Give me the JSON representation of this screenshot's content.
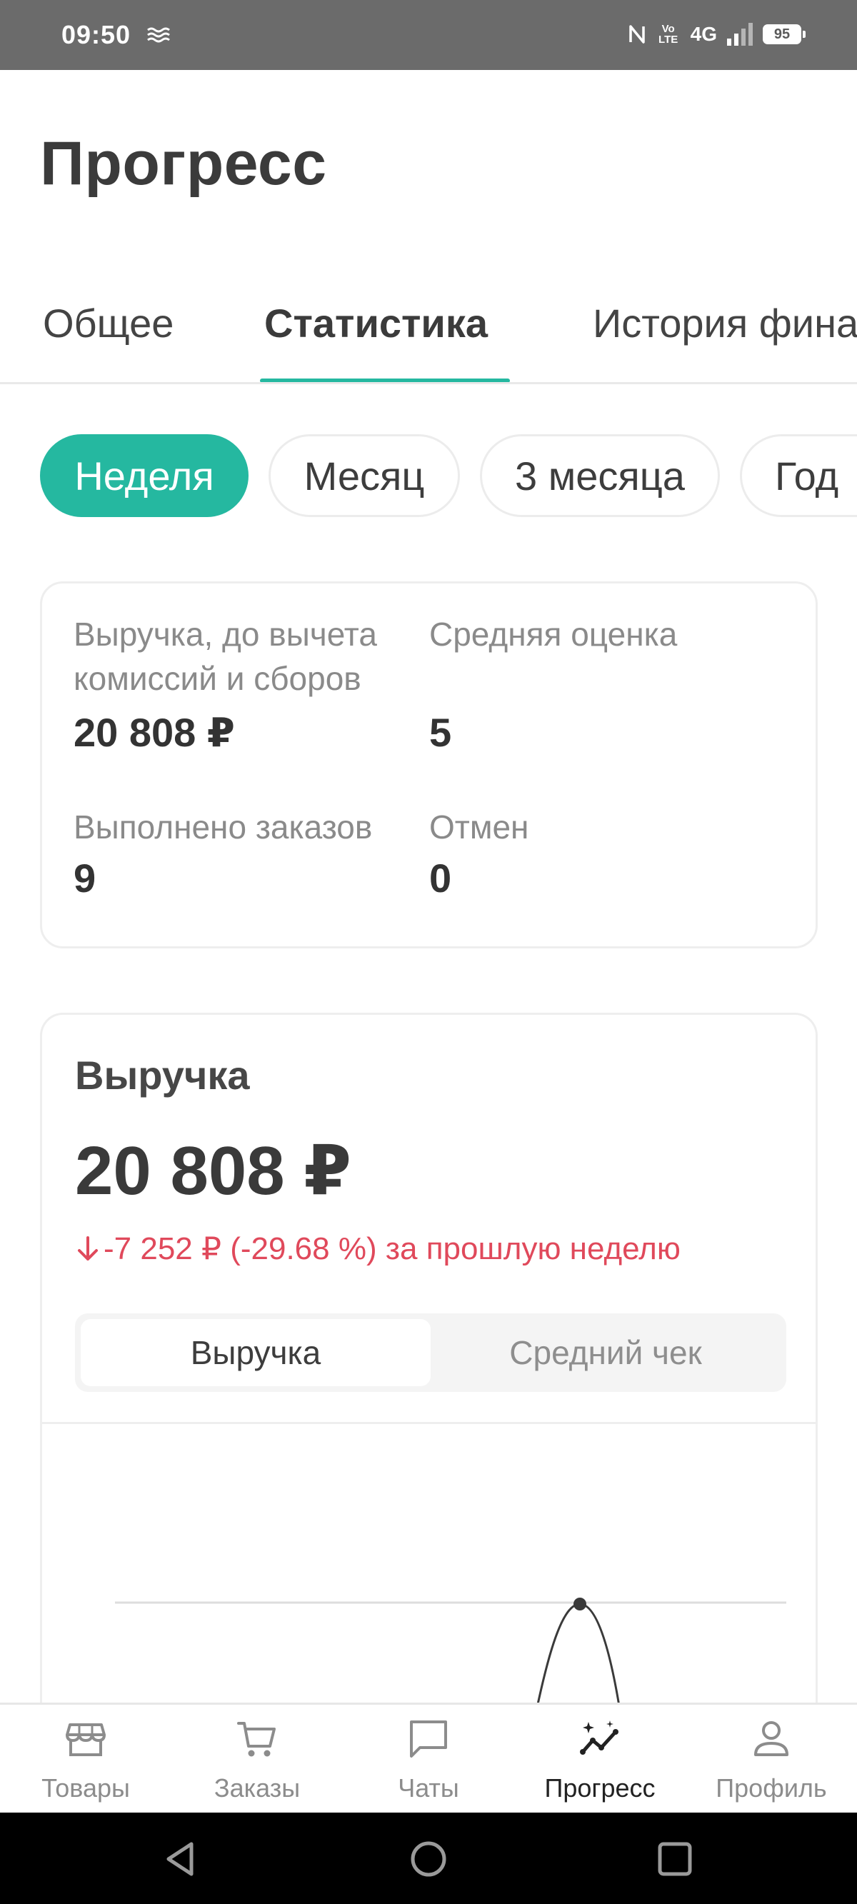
{
  "status_bar": {
    "time": "09:50",
    "network": "4G",
    "volte": "Vo LTE",
    "battery": "95"
  },
  "page": {
    "title": "Прогресс"
  },
  "tabs": [
    {
      "label": "Общее",
      "active": false
    },
    {
      "label": "Статистика",
      "active": true
    },
    {
      "label": "История фина",
      "active": false
    }
  ],
  "periods": [
    {
      "label": "Неделя",
      "active": true
    },
    {
      "label": "Месяц",
      "active": false
    },
    {
      "label": "3 месяца",
      "active": false
    },
    {
      "label": "Год",
      "active": false
    }
  ],
  "summary": {
    "revenue_label": "Выручка, до вычета комиссий и сборов",
    "revenue_value": "20 808 ₽",
    "rating_label": "Средняя оценка",
    "rating_value": "5",
    "orders_label": "Выполнено заказов",
    "orders_value": "9",
    "cancels_label": "Отмен",
    "cancels_value": "0"
  },
  "revenue": {
    "title": "Выручка",
    "amount": "20 808 ₽",
    "change": "-7 252 ₽ (-29.68 %) за прошлую неделю",
    "change_color": "#e0495b",
    "segments": [
      {
        "label": "Выручка",
        "active": true
      },
      {
        "label": "Средний чек",
        "active": false
      }
    ]
  },
  "bottom_nav": [
    {
      "label": "Товары",
      "icon": "store-icon",
      "active": false
    },
    {
      "label": "Заказы",
      "icon": "cart-icon",
      "active": false
    },
    {
      "label": "Чаты",
      "icon": "chat-icon",
      "active": false
    },
    {
      "label": "Прогресс",
      "icon": "progress-icon",
      "active": true
    },
    {
      "label": "Профиль",
      "icon": "profile-icon",
      "active": false
    }
  ],
  "colors": {
    "accent": "#25b8a0",
    "negative": "#e0495b",
    "status_bar": "#6b6b6b"
  }
}
